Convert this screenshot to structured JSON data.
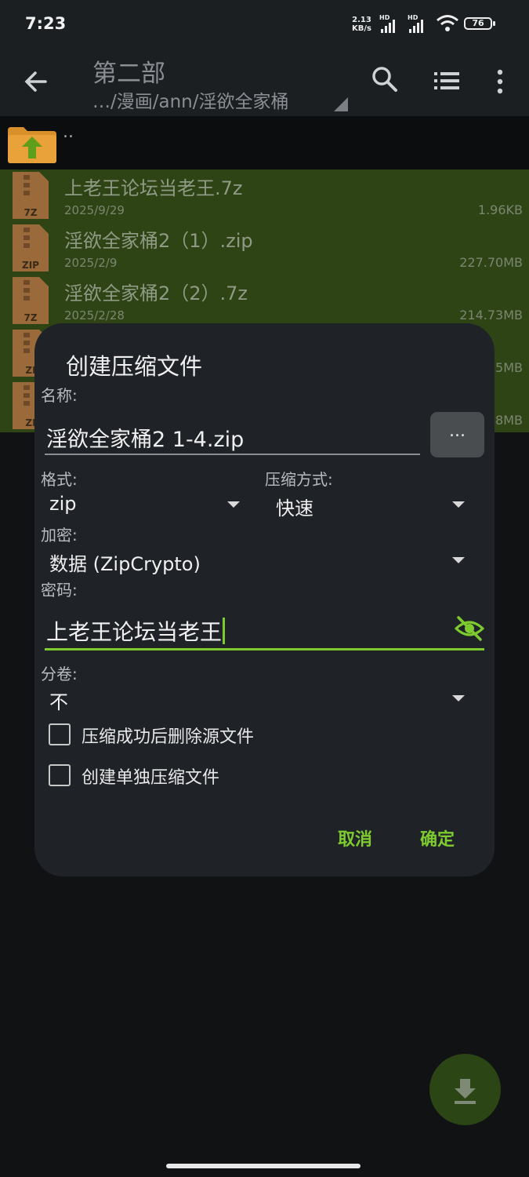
{
  "status_bar": {
    "time": "7:23",
    "net_speed_value": "2.13",
    "net_speed_unit": "KB/s",
    "sim1_badge": "HD",
    "sim2_badge": "HD",
    "battery": "76"
  },
  "toolbar": {
    "title": "第二部",
    "path": "…/漫画/ann/淫欲全家桶"
  },
  "file_list": {
    "parent_label": "..",
    "files": [
      {
        "name": "上老王论坛当老王.7z",
        "date": "2025/9/29",
        "size": "1.96KB",
        "type": "7Z"
      },
      {
        "name": "淫欲全家桶2（1）.zip",
        "date": "2025/2/9",
        "size": "227.70MB",
        "type": "ZIP"
      },
      {
        "name": "淫欲全家桶2（2）.7z",
        "date": "2025/2/28",
        "size": "214.73MB",
        "type": "7Z"
      },
      {
        "name": "",
        "date": "",
        "size": "5MB",
        "type": "ZI"
      },
      {
        "name": "",
        "date": "",
        "size": "8MB",
        "type": "ZI"
      }
    ]
  },
  "dialog": {
    "title": "创建压缩文件",
    "name_label": "名称:",
    "name_value": "淫欲全家桶2 1-4.zip",
    "browse_label": "...",
    "format_label": "格式:",
    "format_value": "zip",
    "method_label": "压缩方式:",
    "method_value": "快速",
    "encryption_label": "加密:",
    "encryption_value": "数据 (ZipCrypto)",
    "password_label": "密码:",
    "password_value": "上老王论坛当老王",
    "split_label": "分卷:",
    "split_value": "不",
    "delete_source_label": "压缩成功后删除源文件",
    "delete_source_checked": false,
    "separate_archives_label": "创建单独压缩文件",
    "separate_archives_checked": false,
    "cancel_label": "取消",
    "ok_label": "确定"
  },
  "colors": {
    "accent": "#7ecb2f",
    "selected_row": "#2f4415",
    "dialog_bg": "#1f2226",
    "app_bg": "#101214"
  },
  "icons": {
    "back": "arrow-left-icon",
    "search": "search-icon",
    "list": "list-view-icon",
    "more": "more-vert-icon",
    "parent_folder": "folder-up-icon",
    "archive": "archive-file-icon",
    "visibility": "visibility-off-icon",
    "fab": "download-icon"
  }
}
